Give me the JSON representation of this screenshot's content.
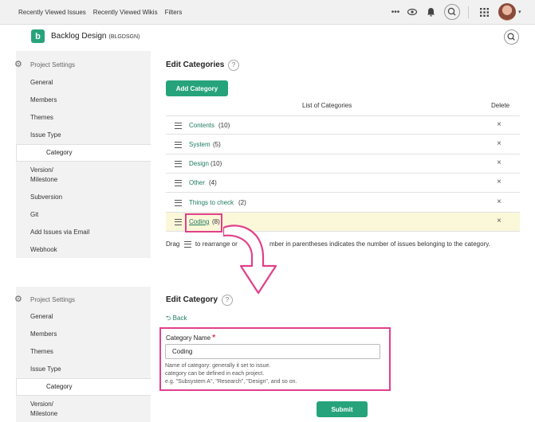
{
  "topnav": {
    "items": [
      "Recently Viewed Issues",
      "Recently Viewed Wikis",
      "Filters"
    ],
    "icons": [
      "more-icon",
      "watch-icon",
      "notification-bell-icon",
      "search-icon",
      "apps-grid-icon",
      "avatar"
    ]
  },
  "project": {
    "logo_letter": "b",
    "name": "Backlog Design",
    "key": "(BLGDSGN)"
  },
  "sidebar": {
    "header": "Project Settings",
    "items": [
      "General",
      "Members",
      "Themes",
      "Issue Type",
      "Category",
      "Version/\nMilestone",
      "Subversion",
      "Git",
      "Add Issues via Email",
      "Webhook"
    ],
    "active": "Category"
  },
  "edit_categories": {
    "title": "Edit Categories",
    "help": "?",
    "add_button": "Add Category",
    "list_header": "List of Categories",
    "delete_header": "Delete",
    "categories": [
      {
        "name": "Contents",
        "count": "(10)"
      },
      {
        "name": "System",
        "count": "(5)"
      },
      {
        "name": "Design",
        "count": "(10)"
      },
      {
        "name": "Other",
        "count": "(4)"
      },
      {
        "name": "Things to check",
        "count": "(2)"
      },
      {
        "name": "Coding",
        "count": "(8)"
      }
    ],
    "delete_symbol": "×",
    "hint_prefix": "Drag",
    "hint_suffix": "to rearrange or",
    "hint_tail": "mber in parentheses indicates the number of issues belonging to the category."
  },
  "edit_category": {
    "title": "Edit Category",
    "help": "?",
    "back": "Back",
    "field_label": "Category Name",
    "required_mark": "*",
    "field_value": "Coding",
    "help_lines": [
      "Name of category: generally it set to issue.",
      "category can be defined in each project.",
      "e.g. \"Subsystem A\", \"Research\", \"Design\", and so on."
    ],
    "submit": "Submit"
  },
  "colors": {
    "brand_green": "#26a37b",
    "link_green": "#1e7b61",
    "highlight_pink": "#e0408a",
    "row_highlight": "#fbf7d9"
  }
}
